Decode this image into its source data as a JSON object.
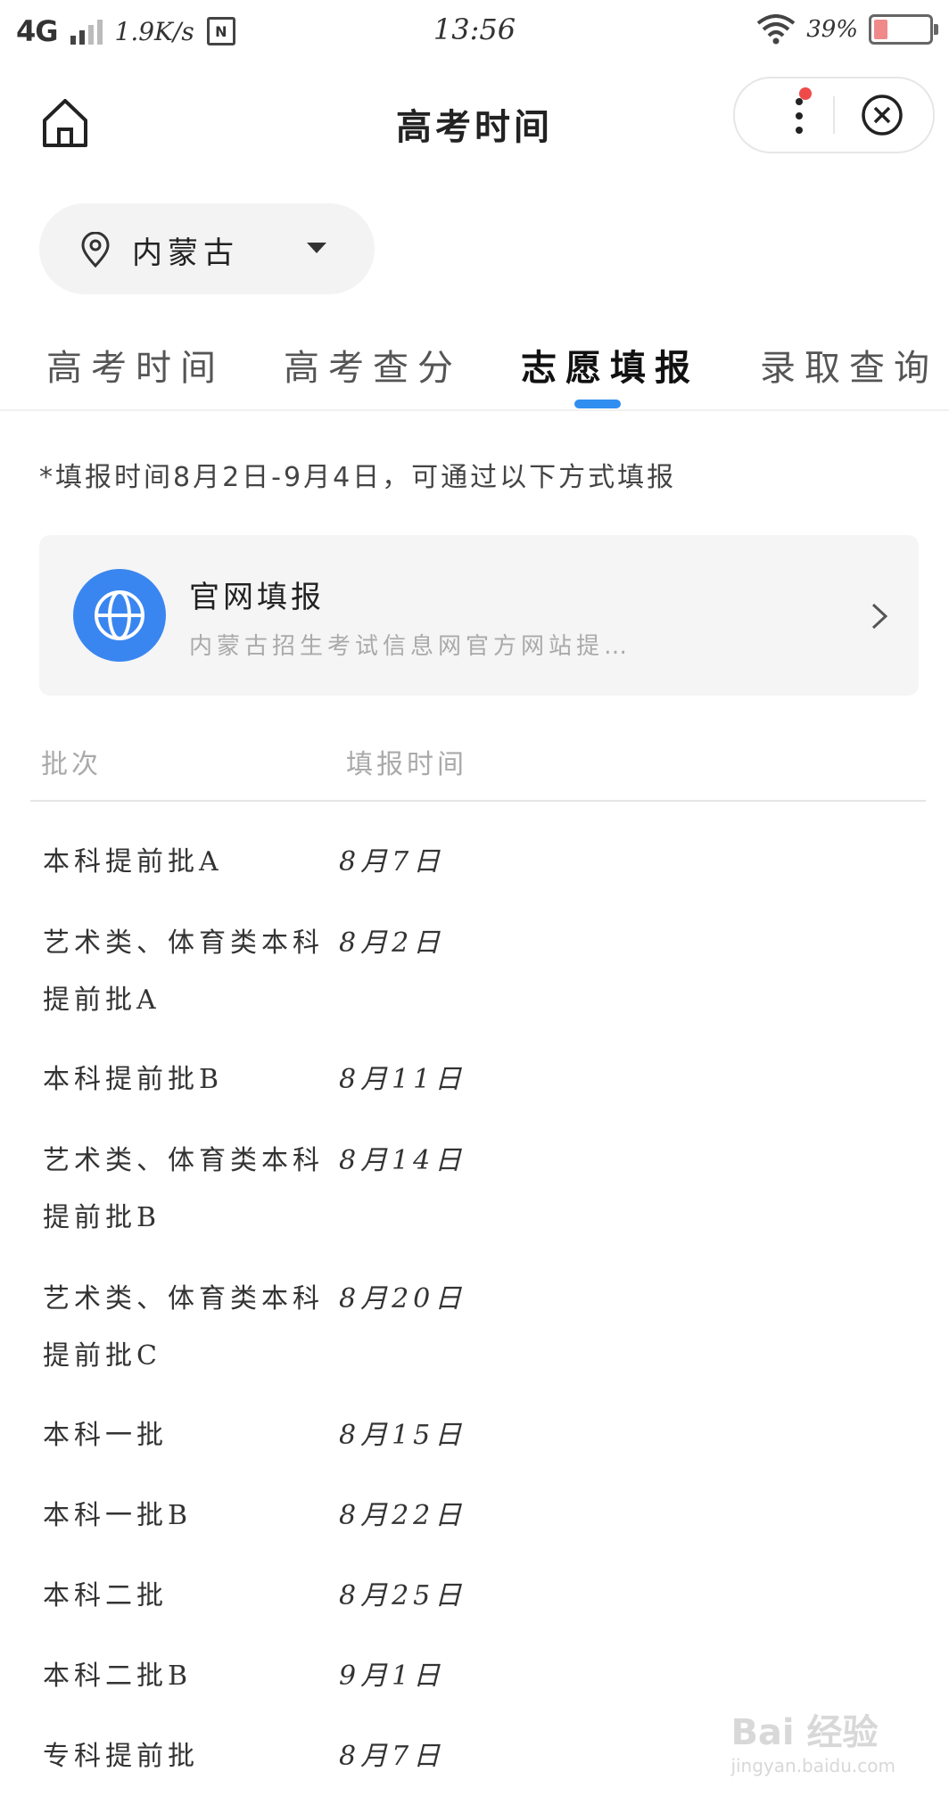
{
  "status_bar": {
    "network": "4G",
    "speed": "1.9K/s",
    "nfc_label": "N",
    "time": "13:56",
    "battery": "39%",
    "battery_level": 0.39
  },
  "nav": {
    "title": "高考时间"
  },
  "location": {
    "label": "内蒙古"
  },
  "tabs": [
    {
      "label": "高考时间",
      "active": false
    },
    {
      "label": "高考查分",
      "active": false
    },
    {
      "label": "志愿填报",
      "active": true
    },
    {
      "label": "录取查询",
      "active": false
    }
  ],
  "note": "*填报时间8月2日-9月4日，可通过以下方式填报",
  "card": {
    "title": "官网填报",
    "subtitle": "内蒙古招生考试信息网官方网站提…"
  },
  "table": {
    "headers": [
      "批次",
      "填报时间"
    ],
    "rows": [
      {
        "batch": "本科提前批A",
        "date": "8月7日"
      },
      {
        "batch": "艺术类、体育类本科提前批A",
        "date": "8月2日"
      },
      {
        "batch": "本科提前批B",
        "date": "8月11日"
      },
      {
        "batch": "艺术类、体育类本科提前批B",
        "date": "8月14日"
      },
      {
        "batch": "艺术类、体育类本科提前批C",
        "date": "8月20日"
      },
      {
        "batch": "本科一批",
        "date": "8月15日"
      },
      {
        "batch": "本科一批B",
        "date": "8月22日"
      },
      {
        "batch": "本科二批",
        "date": "8月25日"
      },
      {
        "batch": "本科二批B",
        "date": "9月1日"
      },
      {
        "batch": "专科提前批",
        "date": "8月7日"
      }
    ]
  },
  "watermark": {
    "brand": "Bai 经验",
    "url": "jingyan.baidu.com"
  }
}
